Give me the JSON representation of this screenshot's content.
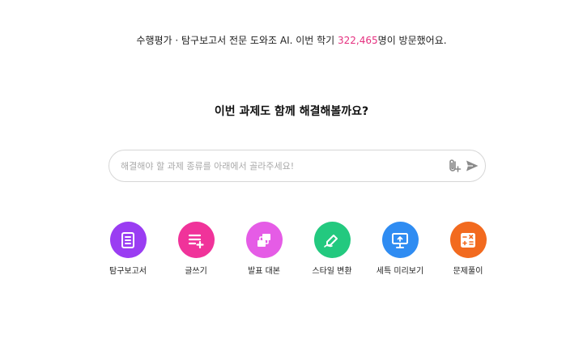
{
  "banner": {
    "prefix": "수행평가 · 탐구보고서 전문 도와조 AI. 이번 학기 ",
    "count": "322,465",
    "suffix": "명이 방문했어요."
  },
  "headline": "이번 과제도 함께 해결해볼까요?",
  "search": {
    "placeholder": "해결해야 할 과제 종류를 아래에서 골라주세요!",
    "value": "",
    "attach_icon": "paperclip-plus-icon",
    "send_icon": "send-icon"
  },
  "categories": [
    {
      "label": "탐구보고서",
      "icon": "document-icon",
      "color": "#9a3df2"
    },
    {
      "label": "글쓰기",
      "icon": "list-add-icon",
      "color": "#f0339a"
    },
    {
      "label": "발표 대본",
      "icon": "slides-icon",
      "color": "#e55ce6"
    },
    {
      "label": "스타일 변환",
      "icon": "pen-swap-icon",
      "color": "#23c97f"
    },
    {
      "label": "세특 미리보기",
      "icon": "presentation-icon",
      "color": "#2f8cf2"
    },
    {
      "label": "문제풀이",
      "icon": "calculator-icon",
      "color": "#f26a1f"
    }
  ]
}
